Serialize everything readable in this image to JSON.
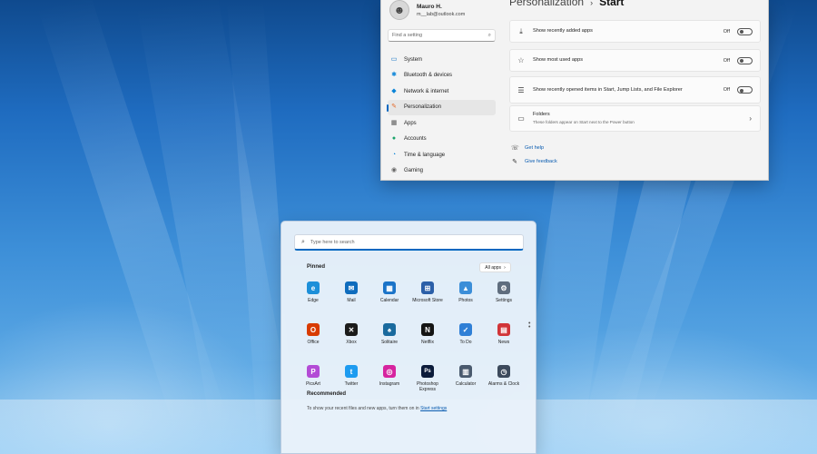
{
  "settings": {
    "user": {
      "name": "Mauro H.",
      "email": "m__lab@outlook.com"
    },
    "search_placeholder": "Find a setting",
    "nav": [
      {
        "label": "System",
        "icon": "monitor-icon",
        "color": "#0067c0"
      },
      {
        "label": "Bluetooth & devices",
        "icon": "bluetooth-icon",
        "color": "#0a84d8"
      },
      {
        "label": "Network & internet",
        "icon": "wifi-icon",
        "color": "#0a84d8"
      },
      {
        "label": "Personalization",
        "icon": "brush-icon",
        "color": "#e46a2a",
        "active": true
      },
      {
        "label": "Apps",
        "icon": "apps-icon",
        "color": "#555555"
      },
      {
        "label": "Accounts",
        "icon": "person-icon",
        "color": "#1aa36a"
      },
      {
        "label": "Time & language",
        "icon": "globe-clock-icon",
        "color": "#0a84d8"
      },
      {
        "label": "Gaming",
        "icon": "gamepad-icon",
        "color": "#666666"
      }
    ],
    "breadcrumb": {
      "parent": "Personalization",
      "current": "Start"
    },
    "options": [
      {
        "label": "Show recently added apps",
        "state": "Off",
        "icon": "download-icon"
      },
      {
        "label": "Show most used apps",
        "state": "Off",
        "icon": "star-icon"
      },
      {
        "label": "Show recently opened items in Start, Jump Lists, and File Explorer",
        "state": "Off",
        "icon": "list-icon"
      }
    ],
    "folders": {
      "title": "Folders",
      "subtitle": "These folders appear on Start next to the Power button"
    },
    "links": {
      "help": "Get help",
      "feedback": "Give feedback"
    }
  },
  "start_menu": {
    "search_placeholder": "Type here to search",
    "pinned_label": "Pinned",
    "all_apps_label": "All apps",
    "apps": [
      {
        "name": "Edge",
        "icon": "edge-icon",
        "color": "#1c8fd9",
        "glyph": "e"
      },
      {
        "name": "Mail",
        "icon": "mail-icon",
        "color": "#0f6cbd",
        "glyph": "✉"
      },
      {
        "name": "Calendar",
        "icon": "calendar-icon",
        "color": "#1a73c8",
        "glyph": "▦"
      },
      {
        "name": "Microsoft Store",
        "icon": "store-icon",
        "color": "#2b5fa8",
        "glyph": "⊞"
      },
      {
        "name": "Photos",
        "icon": "photos-icon",
        "color": "#3b8ed8",
        "glyph": "▲"
      },
      {
        "name": "Settings",
        "icon": "settings-gear-icon",
        "color": "#5f6d7e",
        "glyph": "⚙"
      },
      {
        "name": "Office",
        "icon": "office-icon",
        "color": "#d83b01",
        "glyph": "O"
      },
      {
        "name": "Xbox",
        "icon": "xbox-icon",
        "color": "#1b1b1b",
        "glyph": "✕"
      },
      {
        "name": "Solitaire",
        "icon": "solitaire-icon",
        "color": "#1a6a9e",
        "glyph": "♠"
      },
      {
        "name": "Netflix",
        "icon": "netflix-icon",
        "color": "#141414",
        "glyph": "N"
      },
      {
        "name": "To Do",
        "icon": "todo-icon",
        "color": "#2f7fd6",
        "glyph": "✓"
      },
      {
        "name": "News",
        "icon": "news-icon",
        "color": "#d13438",
        "glyph": "▤"
      },
      {
        "name": "PicsArt",
        "icon": "picsart-icon",
        "color": "#b34bd6",
        "glyph": "P"
      },
      {
        "name": "Twitter",
        "icon": "twitter-icon",
        "color": "#1d9bf0",
        "glyph": "t"
      },
      {
        "name": "Instagram",
        "icon": "instagram-icon",
        "color": "#d6249f",
        "glyph": "◎"
      },
      {
        "name": "Photoshop Express",
        "icon": "photoshop-express-icon",
        "color": "#0b1b3a",
        "glyph": "Ps"
      },
      {
        "name": "Calculator",
        "icon": "calculator-icon",
        "color": "#4a5a6e",
        "glyph": "▥"
      },
      {
        "name": "Alarms & Clock",
        "icon": "clock-icon",
        "color": "#3c4a5c",
        "glyph": "◷"
      }
    ],
    "recommended_label": "Recommended",
    "recommended_text": "To show your recent files and new apps, turn them on in",
    "recommended_link": "Start settings"
  }
}
